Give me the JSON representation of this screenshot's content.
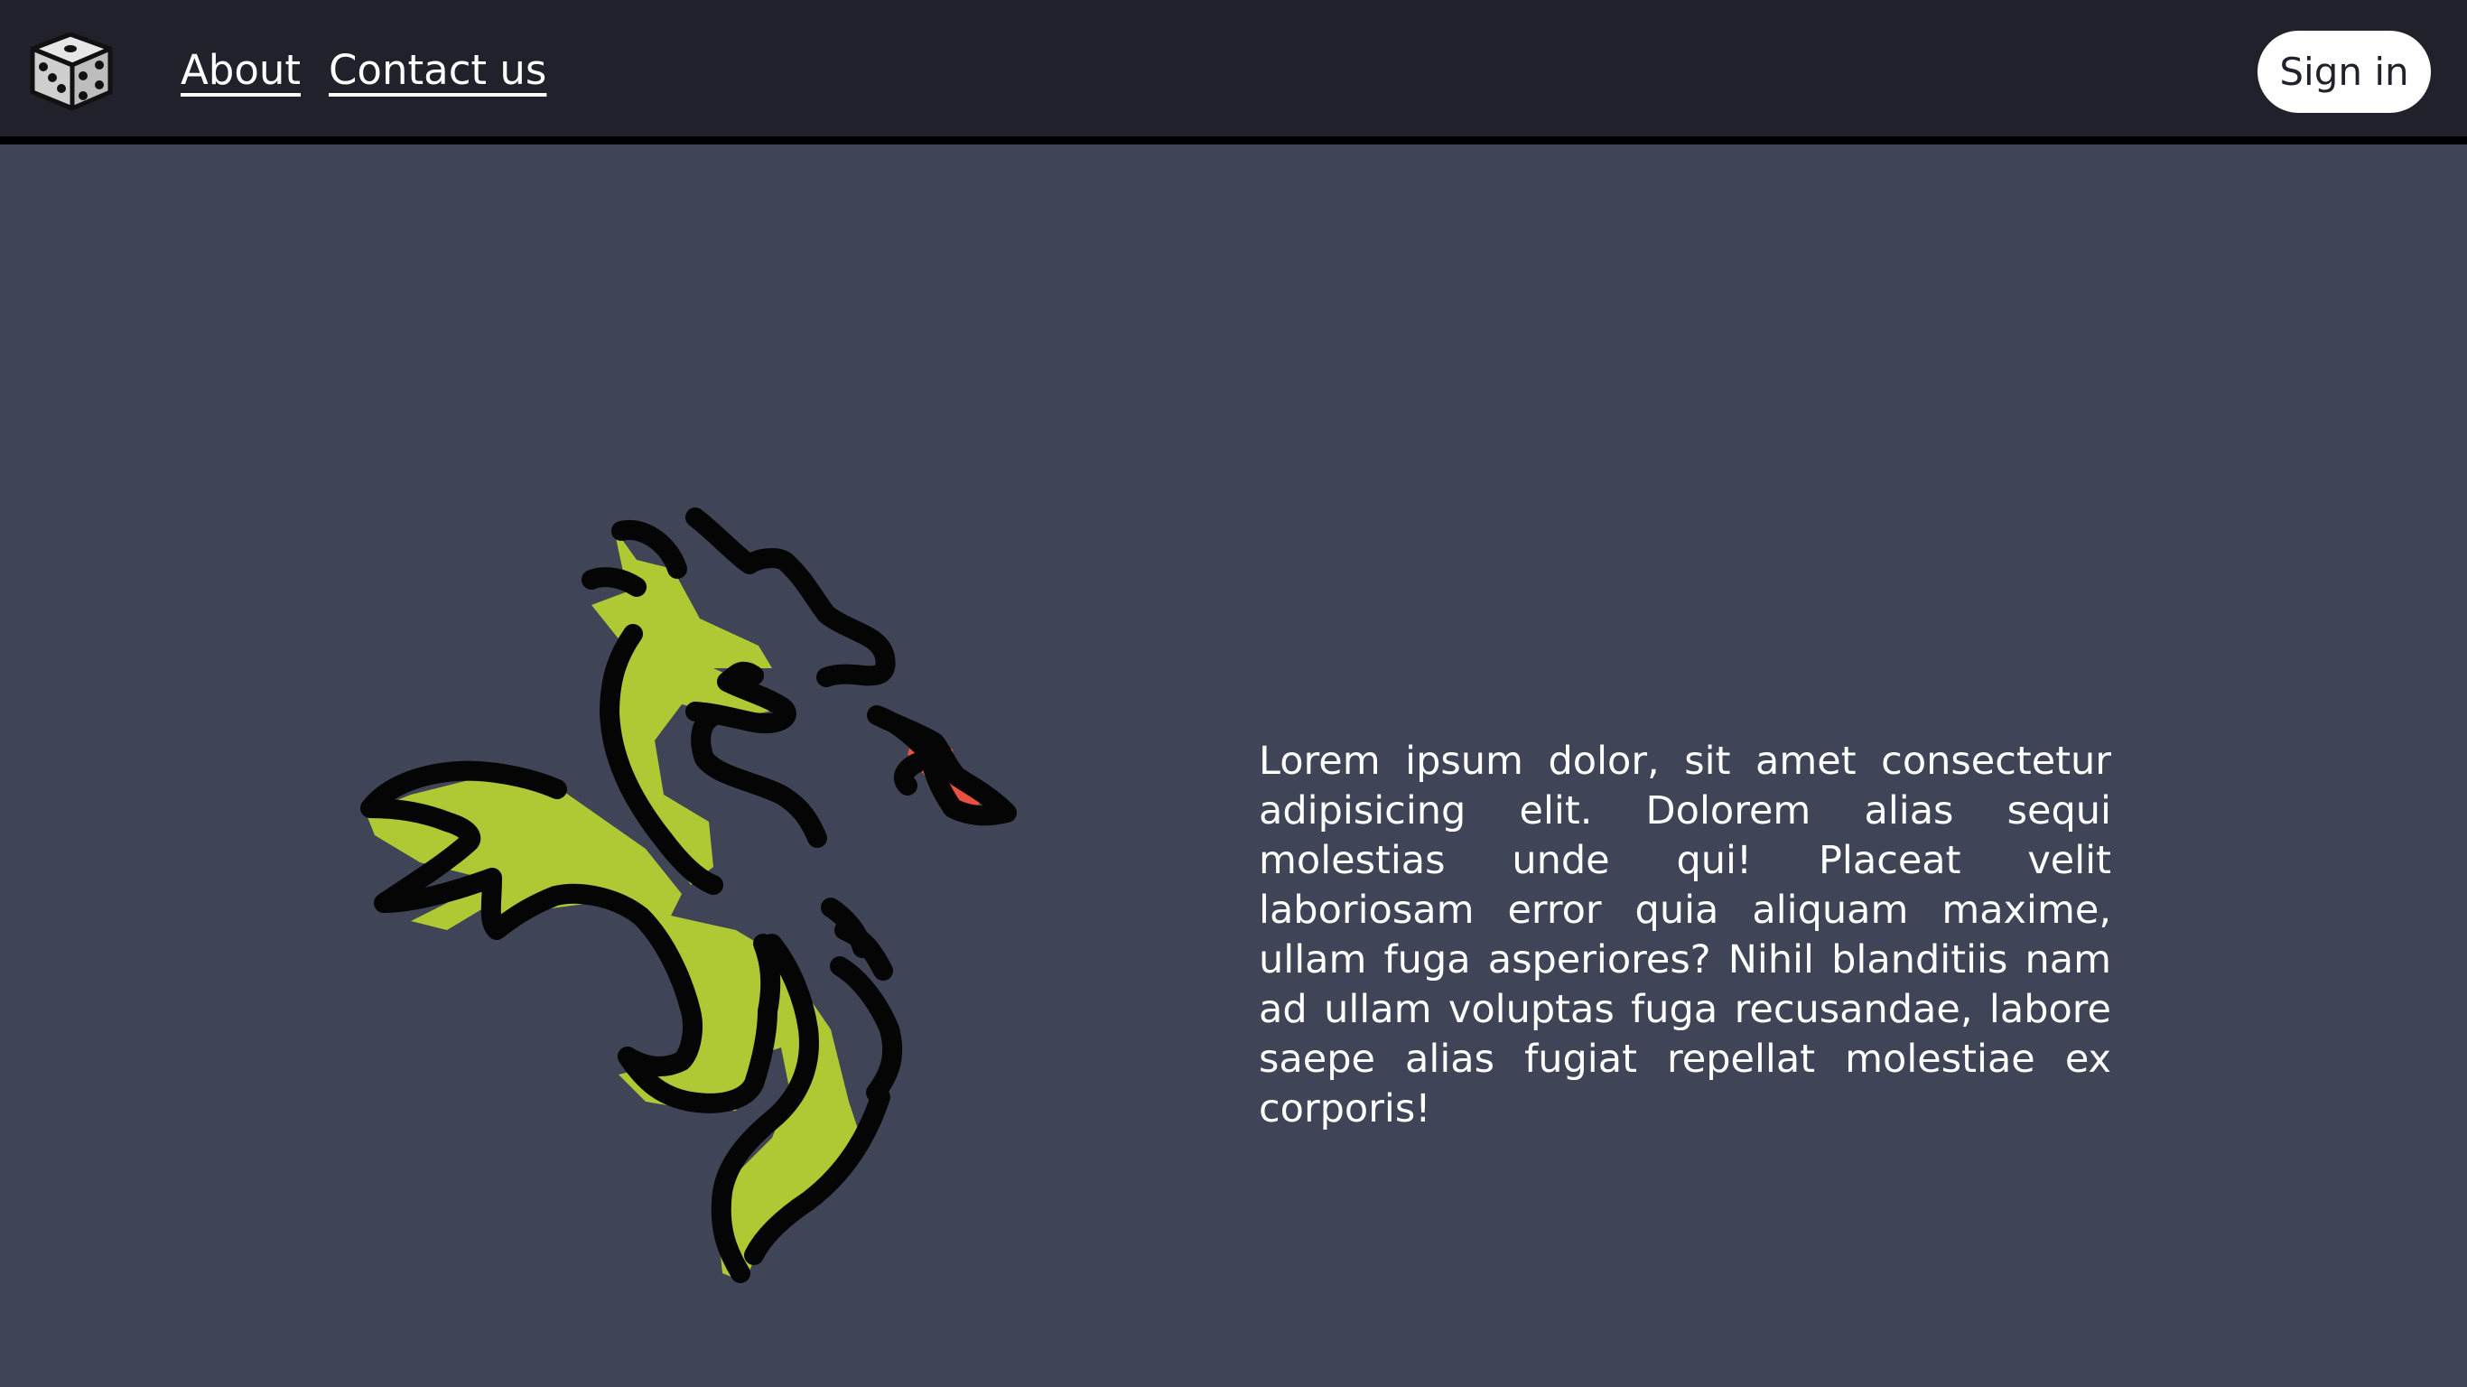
{
  "header": {
    "logo_icon": "dice-icon",
    "nav": [
      {
        "label": "About"
      },
      {
        "label": "Contact us"
      }
    ],
    "sign_in_label": "Sign in"
  },
  "main": {
    "illustration": "dragon-illustration",
    "paragraph": "Lorem ipsum dolor, sit amet consectetur adipisicing elit. Dolorem alias sequi molestias unde qui! Placeat velit laboriosam error quia aliquam maxime, ullam fuga asperiores? Nihil blanditiis nam ad ullam voluptas fuga recusandae, labore saepe alias fugiat repellat molestiae ex corporis!"
  },
  "colors": {
    "header_bg": "#21212b",
    "page_bg": "#3f4456",
    "dragon_green": "#afc934",
    "flame_red": "#e8513f",
    "button_bg": "#ffffff"
  }
}
